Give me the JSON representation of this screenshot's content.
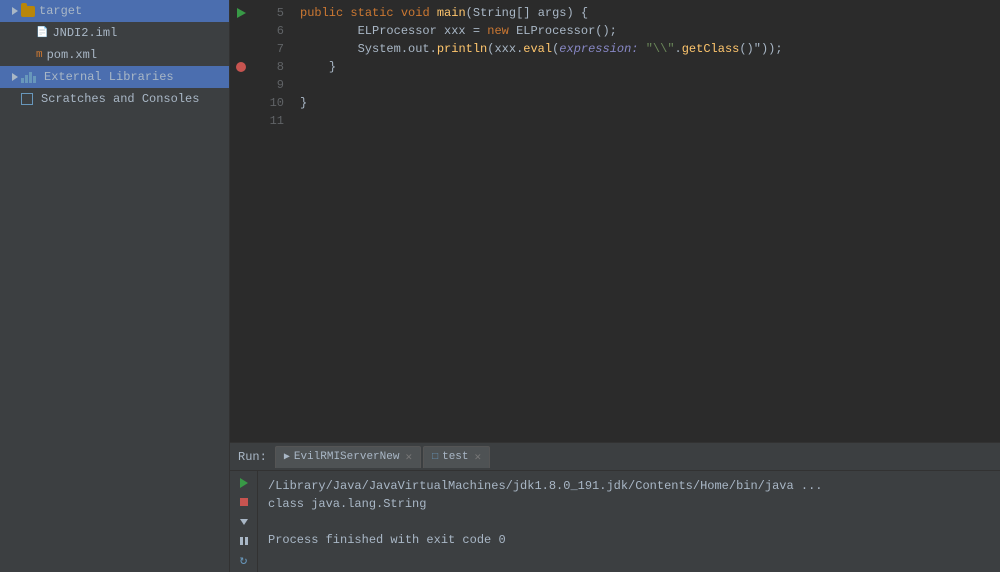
{
  "sidebar": {
    "items": [
      {
        "id": "target",
        "label": "target",
        "type": "folder",
        "indent": 0,
        "expanded": true
      },
      {
        "id": "jndi2",
        "label": "JNDI2.iml",
        "type": "iml",
        "indent": 1
      },
      {
        "id": "pom",
        "label": "pom.xml",
        "type": "maven",
        "indent": 1
      },
      {
        "id": "external-libraries",
        "label": "External Libraries",
        "type": "libraries",
        "indent": 0,
        "expanded": false,
        "selected": true
      },
      {
        "id": "scratches",
        "label": "Scratches and Consoles",
        "type": "scratches",
        "indent": 0
      }
    ]
  },
  "editor": {
    "lines": [
      {
        "num": 5,
        "content": "    public static void main(String[] args) {",
        "gutter": "run"
      },
      {
        "num": 6,
        "content": "        ELProcessor xxx = new ELProcessor();"
      },
      {
        "num": 7,
        "content": "        System.out.println(xxx.eval( expression: \"\\\\\\\\\".getClass()\"));"
      },
      {
        "num": 8,
        "content": "    }",
        "gutter": "breakpoint"
      },
      {
        "num": 9,
        "content": ""
      },
      {
        "num": 10,
        "content": "}"
      },
      {
        "num": 11,
        "content": ""
      }
    ]
  },
  "bottom": {
    "run_label": "Run:",
    "tabs": [
      {
        "id": "evildemo",
        "label": "EvilRMIServerNew",
        "active": false
      },
      {
        "id": "test",
        "label": "test",
        "active": false
      }
    ],
    "console_lines": [
      {
        "text": "/Library/Java/JavaVirtualMachines/jdk1.8.0_191.jdk/Contents/Home/bin/java ..."
      },
      {
        "text": "class java.lang.String"
      },
      {
        "text": ""
      },
      {
        "text": "Process finished with exit code 0"
      }
    ]
  }
}
